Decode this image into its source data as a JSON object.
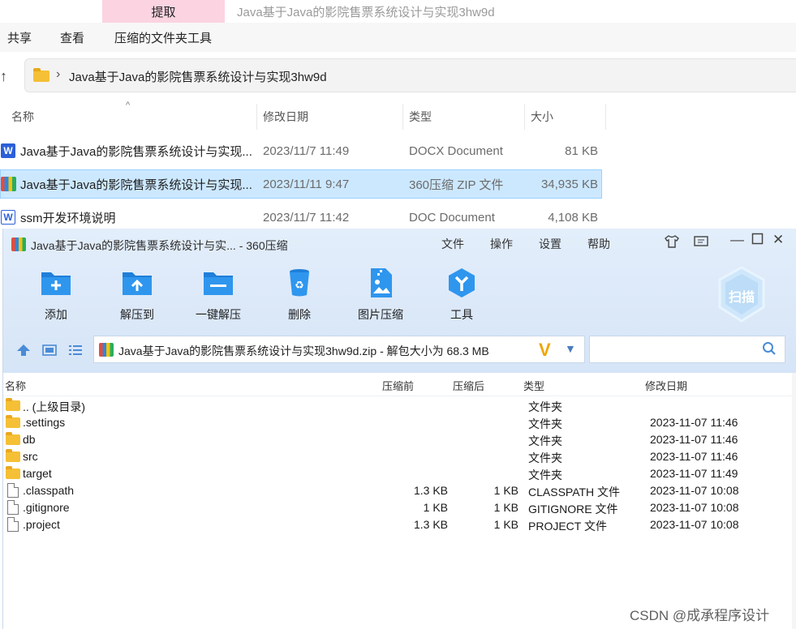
{
  "explorer": {
    "context_tab": "提取",
    "window_title": "Java基于Java的影院售票系统设计与实现3hw9d",
    "ribbon_menu": [
      "共享",
      "查看",
      "压缩的文件夹工具"
    ],
    "address": "Java基于Java的影院售票系统设计与实现3hw9d",
    "columns": [
      "名称",
      "修改日期",
      "类型",
      "大小"
    ],
    "files": [
      {
        "icon": "word-icon",
        "name": "Java基于Java的影院售票系统设计与实现...",
        "date": "2023/11/7 11:49",
        "type": "DOCX Document",
        "size": "81 KB",
        "selected": false
      },
      {
        "icon": "zip-archive-icon",
        "name": "Java基于Java的影院售票系统设计与实现...",
        "date": "2023/11/11 9:47",
        "type": "360压缩 ZIP 文件",
        "size": "34,935 KB",
        "selected": true
      },
      {
        "icon": "word-doc-icon",
        "name": "ssm开发环境说明",
        "date": "2023/11/7 11:42",
        "type": "DOC Document",
        "size": "4,108 KB",
        "selected": false
      }
    ]
  },
  "zip": {
    "title": "Java基于Java的影院售票系统设计与实... - 360压缩",
    "menu": [
      "文件",
      "操作",
      "设置",
      "帮助"
    ],
    "tools": [
      {
        "label": "添加",
        "icon": "add-folder-icon"
      },
      {
        "label": "解压到",
        "icon": "extract-to-icon"
      },
      {
        "label": "一键解压",
        "icon": "one-click-extract-icon"
      },
      {
        "label": "删除",
        "icon": "recycle-bin-icon"
      },
      {
        "label": "图片压缩",
        "icon": "image-compress-icon"
      },
      {
        "label": "工具",
        "icon": "tools-icon"
      }
    ],
    "scan_label": "扫描",
    "address": "Java基于Java的影院售票系统设计与实现3hw9d.zip - 解包大小为 68.3 MB",
    "columns": [
      "名称",
      "压缩前",
      "压缩后",
      "类型",
      "修改日期"
    ],
    "rows": [
      {
        "kind": "folder",
        "name": ".. (上级目录)",
        "before": "",
        "after": "",
        "type": "文件夹",
        "date": ""
      },
      {
        "kind": "folder",
        "name": ".settings",
        "before": "",
        "after": "",
        "type": "文件夹",
        "date": "2023-11-07 11:46"
      },
      {
        "kind": "folder",
        "name": "db",
        "before": "",
        "after": "",
        "type": "文件夹",
        "date": "2023-11-07 11:46"
      },
      {
        "kind": "folder",
        "name": "src",
        "before": "",
        "after": "",
        "type": "文件夹",
        "date": "2023-11-07 11:46"
      },
      {
        "kind": "folder",
        "name": "target",
        "before": "",
        "after": "",
        "type": "文件夹",
        "date": "2023-11-07 11:49"
      },
      {
        "kind": "file",
        "name": ".classpath",
        "before": "1.3 KB",
        "after": "1 KB",
        "type": "CLASSPATH 文件",
        "date": "2023-11-07 10:08"
      },
      {
        "kind": "file",
        "name": ".gitignore",
        "before": "1 KB",
        "after": "1 KB",
        "type": "GITIGNORE 文件",
        "date": "2023-11-07 10:08"
      },
      {
        "kind": "file",
        "name": ".project",
        "before": "1.3 KB",
        "after": "1 KB",
        "type": "PROJECT 文件",
        "date": "2023-11-07 10:08"
      }
    ]
  },
  "watermark": "CSDN @成承程序设计",
  "colors": {
    "selection": "#cce8ff",
    "zip_header": "#dbe8f8",
    "accent_blue": "#2f86de"
  }
}
